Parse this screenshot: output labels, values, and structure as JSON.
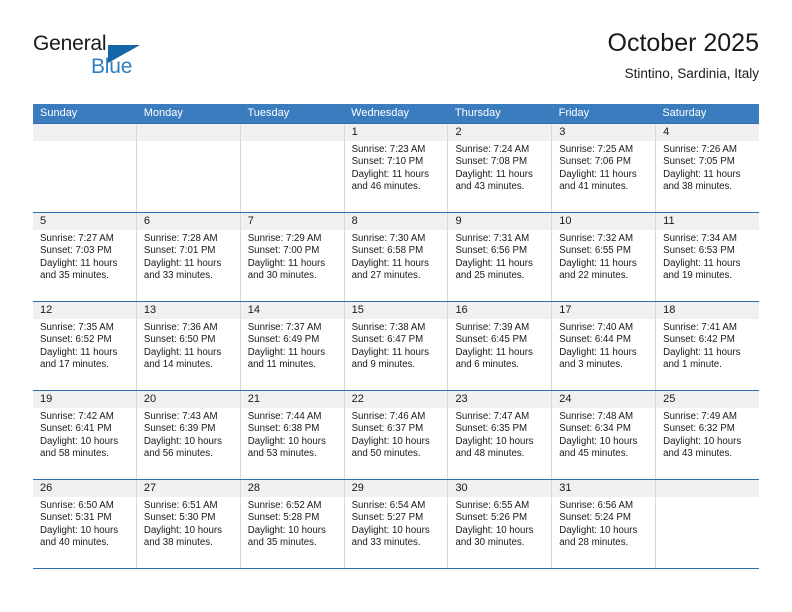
{
  "brand": {
    "name_part1": "General",
    "name_part2": "Blue",
    "flag_icon": "triangle-flag-icon",
    "accent_color": "#2e7fc4"
  },
  "header": {
    "title": "October 2025",
    "subtitle": "Stintino, Sardinia, Italy"
  },
  "theme": {
    "header_row_bg": "#3a7cbe",
    "cell_daynum_bg": "#f0f0f0",
    "grid_line": "#d8d8d8",
    "week_divider": "#2f6fae"
  },
  "weekday_headers": [
    "Sunday",
    "Monday",
    "Tuesday",
    "Wednesday",
    "Thursday",
    "Friday",
    "Saturday"
  ],
  "weeks": [
    [
      {
        "day": "",
        "empty": true,
        "sunrise": "",
        "sunset": "",
        "daylight_line1": "",
        "daylight_line2": ""
      },
      {
        "day": "",
        "empty": true,
        "sunrise": "",
        "sunset": "",
        "daylight_line1": "",
        "daylight_line2": ""
      },
      {
        "day": "",
        "empty": true,
        "sunrise": "",
        "sunset": "",
        "daylight_line1": "",
        "daylight_line2": ""
      },
      {
        "day": "1",
        "empty": false,
        "sunrise": "Sunrise: 7:23 AM",
        "sunset": "Sunset: 7:10 PM",
        "daylight_line1": "Daylight: 11 hours",
        "daylight_line2": "and 46 minutes."
      },
      {
        "day": "2",
        "empty": false,
        "sunrise": "Sunrise: 7:24 AM",
        "sunset": "Sunset: 7:08 PM",
        "daylight_line1": "Daylight: 11 hours",
        "daylight_line2": "and 43 minutes."
      },
      {
        "day": "3",
        "empty": false,
        "sunrise": "Sunrise: 7:25 AM",
        "sunset": "Sunset: 7:06 PM",
        "daylight_line1": "Daylight: 11 hours",
        "daylight_line2": "and 41 minutes."
      },
      {
        "day": "4",
        "empty": false,
        "sunrise": "Sunrise: 7:26 AM",
        "sunset": "Sunset: 7:05 PM",
        "daylight_line1": "Daylight: 11 hours",
        "daylight_line2": "and 38 minutes."
      }
    ],
    [
      {
        "day": "5",
        "empty": false,
        "sunrise": "Sunrise: 7:27 AM",
        "sunset": "Sunset: 7:03 PM",
        "daylight_line1": "Daylight: 11 hours",
        "daylight_line2": "and 35 minutes."
      },
      {
        "day": "6",
        "empty": false,
        "sunrise": "Sunrise: 7:28 AM",
        "sunset": "Sunset: 7:01 PM",
        "daylight_line1": "Daylight: 11 hours",
        "daylight_line2": "and 33 minutes."
      },
      {
        "day": "7",
        "empty": false,
        "sunrise": "Sunrise: 7:29 AM",
        "sunset": "Sunset: 7:00 PM",
        "daylight_line1": "Daylight: 11 hours",
        "daylight_line2": "and 30 minutes."
      },
      {
        "day": "8",
        "empty": false,
        "sunrise": "Sunrise: 7:30 AM",
        "sunset": "Sunset: 6:58 PM",
        "daylight_line1": "Daylight: 11 hours",
        "daylight_line2": "and 27 minutes."
      },
      {
        "day": "9",
        "empty": false,
        "sunrise": "Sunrise: 7:31 AM",
        "sunset": "Sunset: 6:56 PM",
        "daylight_line1": "Daylight: 11 hours",
        "daylight_line2": "and 25 minutes."
      },
      {
        "day": "10",
        "empty": false,
        "sunrise": "Sunrise: 7:32 AM",
        "sunset": "Sunset: 6:55 PM",
        "daylight_line1": "Daylight: 11 hours",
        "daylight_line2": "and 22 minutes."
      },
      {
        "day": "11",
        "empty": false,
        "sunrise": "Sunrise: 7:34 AM",
        "sunset": "Sunset: 6:53 PM",
        "daylight_line1": "Daylight: 11 hours",
        "daylight_line2": "and 19 minutes."
      }
    ],
    [
      {
        "day": "12",
        "empty": false,
        "sunrise": "Sunrise: 7:35 AM",
        "sunset": "Sunset: 6:52 PM",
        "daylight_line1": "Daylight: 11 hours",
        "daylight_line2": "and 17 minutes."
      },
      {
        "day": "13",
        "empty": false,
        "sunrise": "Sunrise: 7:36 AM",
        "sunset": "Sunset: 6:50 PM",
        "daylight_line1": "Daylight: 11 hours",
        "daylight_line2": "and 14 minutes."
      },
      {
        "day": "14",
        "empty": false,
        "sunrise": "Sunrise: 7:37 AM",
        "sunset": "Sunset: 6:49 PM",
        "daylight_line1": "Daylight: 11 hours",
        "daylight_line2": "and 11 minutes."
      },
      {
        "day": "15",
        "empty": false,
        "sunrise": "Sunrise: 7:38 AM",
        "sunset": "Sunset: 6:47 PM",
        "daylight_line1": "Daylight: 11 hours",
        "daylight_line2": "and 9 minutes."
      },
      {
        "day": "16",
        "empty": false,
        "sunrise": "Sunrise: 7:39 AM",
        "sunset": "Sunset: 6:45 PM",
        "daylight_line1": "Daylight: 11 hours",
        "daylight_line2": "and 6 minutes."
      },
      {
        "day": "17",
        "empty": false,
        "sunrise": "Sunrise: 7:40 AM",
        "sunset": "Sunset: 6:44 PM",
        "daylight_line1": "Daylight: 11 hours",
        "daylight_line2": "and 3 minutes."
      },
      {
        "day": "18",
        "empty": false,
        "sunrise": "Sunrise: 7:41 AM",
        "sunset": "Sunset: 6:42 PM",
        "daylight_line1": "Daylight: 11 hours",
        "daylight_line2": "and 1 minute."
      }
    ],
    [
      {
        "day": "19",
        "empty": false,
        "sunrise": "Sunrise: 7:42 AM",
        "sunset": "Sunset: 6:41 PM",
        "daylight_line1": "Daylight: 10 hours",
        "daylight_line2": "and 58 minutes."
      },
      {
        "day": "20",
        "empty": false,
        "sunrise": "Sunrise: 7:43 AM",
        "sunset": "Sunset: 6:39 PM",
        "daylight_line1": "Daylight: 10 hours",
        "daylight_line2": "and 56 minutes."
      },
      {
        "day": "21",
        "empty": false,
        "sunrise": "Sunrise: 7:44 AM",
        "sunset": "Sunset: 6:38 PM",
        "daylight_line1": "Daylight: 10 hours",
        "daylight_line2": "and 53 minutes."
      },
      {
        "day": "22",
        "empty": false,
        "sunrise": "Sunrise: 7:46 AM",
        "sunset": "Sunset: 6:37 PM",
        "daylight_line1": "Daylight: 10 hours",
        "daylight_line2": "and 50 minutes."
      },
      {
        "day": "23",
        "empty": false,
        "sunrise": "Sunrise: 7:47 AM",
        "sunset": "Sunset: 6:35 PM",
        "daylight_line1": "Daylight: 10 hours",
        "daylight_line2": "and 48 minutes."
      },
      {
        "day": "24",
        "empty": false,
        "sunrise": "Sunrise: 7:48 AM",
        "sunset": "Sunset: 6:34 PM",
        "daylight_line1": "Daylight: 10 hours",
        "daylight_line2": "and 45 minutes."
      },
      {
        "day": "25",
        "empty": false,
        "sunrise": "Sunrise: 7:49 AM",
        "sunset": "Sunset: 6:32 PM",
        "daylight_line1": "Daylight: 10 hours",
        "daylight_line2": "and 43 minutes."
      }
    ],
    [
      {
        "day": "26",
        "empty": false,
        "sunrise": "Sunrise: 6:50 AM",
        "sunset": "Sunset: 5:31 PM",
        "daylight_line1": "Daylight: 10 hours",
        "daylight_line2": "and 40 minutes."
      },
      {
        "day": "27",
        "empty": false,
        "sunrise": "Sunrise: 6:51 AM",
        "sunset": "Sunset: 5:30 PM",
        "daylight_line1": "Daylight: 10 hours",
        "daylight_line2": "and 38 minutes."
      },
      {
        "day": "28",
        "empty": false,
        "sunrise": "Sunrise: 6:52 AM",
        "sunset": "Sunset: 5:28 PM",
        "daylight_line1": "Daylight: 10 hours",
        "daylight_line2": "and 35 minutes."
      },
      {
        "day": "29",
        "empty": false,
        "sunrise": "Sunrise: 6:54 AM",
        "sunset": "Sunset: 5:27 PM",
        "daylight_line1": "Daylight: 10 hours",
        "daylight_line2": "and 33 minutes."
      },
      {
        "day": "30",
        "empty": false,
        "sunrise": "Sunrise: 6:55 AM",
        "sunset": "Sunset: 5:26 PM",
        "daylight_line1": "Daylight: 10 hours",
        "daylight_line2": "and 30 minutes."
      },
      {
        "day": "31",
        "empty": false,
        "sunrise": "Sunrise: 6:56 AM",
        "sunset": "Sunset: 5:24 PM",
        "daylight_line1": "Daylight: 10 hours",
        "daylight_line2": "and 28 minutes."
      },
      {
        "day": "",
        "empty": true,
        "sunrise": "",
        "sunset": "",
        "daylight_line1": "",
        "daylight_line2": ""
      }
    ]
  ]
}
